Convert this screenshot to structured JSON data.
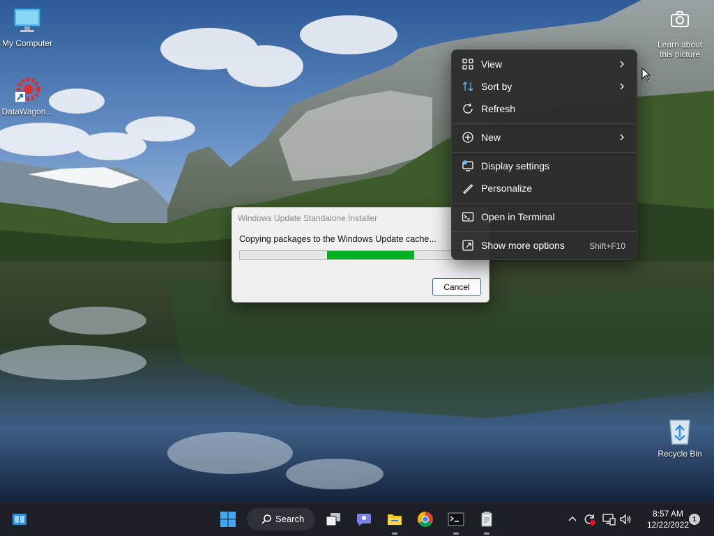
{
  "desktop": {
    "icons": [
      {
        "label": "My Computer"
      },
      {
        "label": "DataWagon..."
      },
      {
        "label": "Recycle Bin"
      }
    ],
    "spotlight": {
      "line1": "Learn about",
      "line2": "this picture"
    }
  },
  "dialog": {
    "title": "Windows Update Standalone Installer",
    "message": "Copying packages to the Windows Update cache...",
    "cancel_label": "Cancel",
    "progress_fraction": 0.36
  },
  "context_menu": {
    "items": [
      {
        "label": "View"
      },
      {
        "label": "Sort by"
      },
      {
        "label": "Refresh"
      },
      {
        "label": "New"
      },
      {
        "label": "Display settings"
      },
      {
        "label": "Personalize"
      },
      {
        "label": "Open in Terminal"
      },
      {
        "label": "Show more options",
        "shortcut": "Shift+F10"
      }
    ]
  },
  "taskbar": {
    "search_label": "Search",
    "time": "8:57 AM",
    "date": "12/22/2022",
    "notification_count": "1"
  },
  "colors": {
    "progress_green": "#06b025",
    "button_border": "#1f6fd6",
    "menu_bg": "#2c2c2c",
    "taskbar_bg": "#1c1f26"
  },
  "icons": [
    "monitor-icon",
    "gear-shortcut-icon",
    "camera-icon",
    "recycle-bin-icon",
    "view-icon",
    "sort-icon",
    "refresh-icon",
    "new-icon",
    "display-settings-icon",
    "personalize-icon",
    "terminal-icon",
    "more-options-icon",
    "chevron-right-icon",
    "widgets-icon",
    "start-icon",
    "search-icon",
    "task-view-icon",
    "chat-icon",
    "file-explorer-icon",
    "chrome-icon",
    "terminal-app-icon",
    "installer-icon",
    "show-hidden-icons-icon",
    "update-icon",
    "network-icon",
    "volume-icon"
  ]
}
